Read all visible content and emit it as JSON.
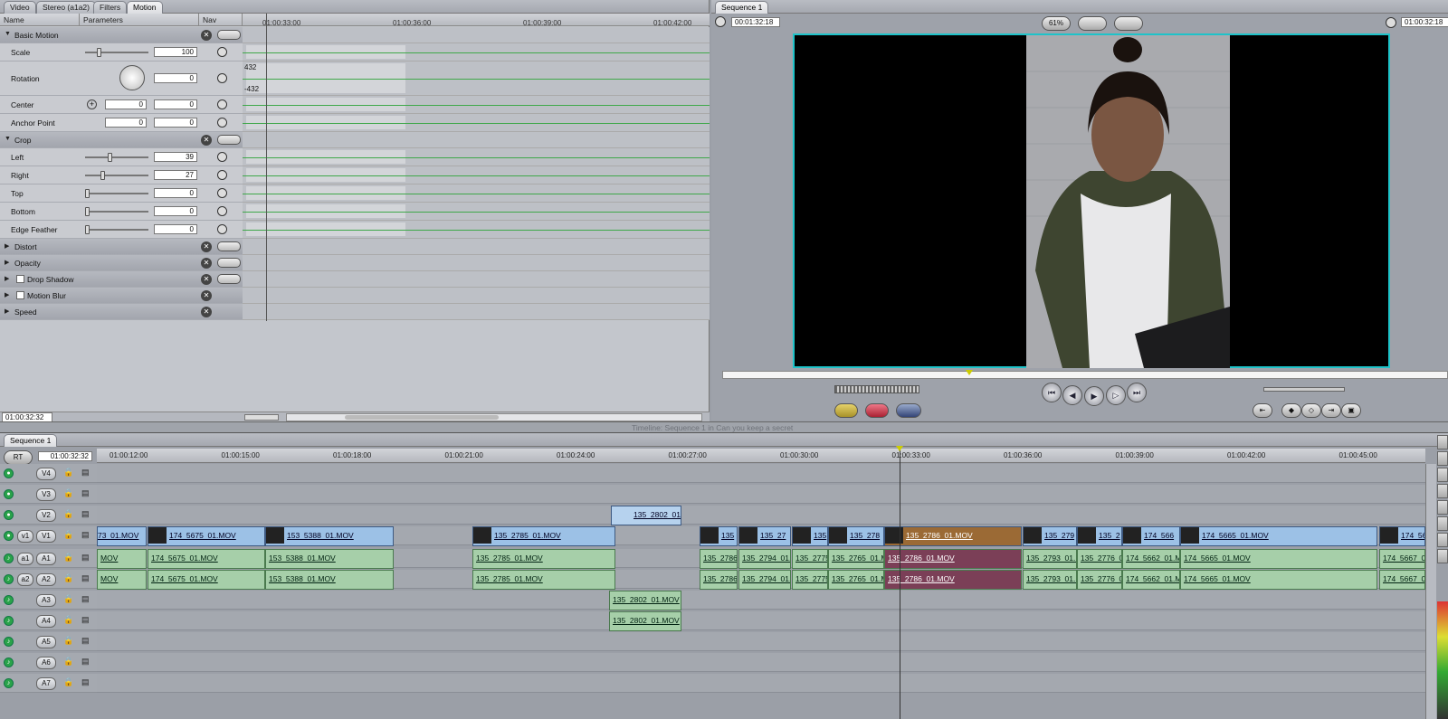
{
  "viewer": {
    "tabs": [
      "Video",
      "Stereo (a1a2)",
      "Filters",
      "Motion"
    ],
    "columns": {
      "name": "Name",
      "params": "Parameters",
      "nav": "Nav"
    },
    "ruler": [
      "01:00:33:00",
      "01:00:36:00",
      "01:00:39:00",
      "01:00:42:00"
    ],
    "timecode": "01:00:32:32",
    "rows": [
      {
        "type": "group",
        "name": "Basic Motion",
        "open": true
      },
      {
        "type": "param",
        "name": "Scale",
        "value": "100",
        "slider": 0.2
      },
      {
        "type": "param",
        "name": "Rotation",
        "value": "0",
        "dial": true,
        "kf_top": "432",
        "kf_bottom": "-432"
      },
      {
        "type": "param",
        "name": "Center",
        "value1": "0",
        "value2": "0",
        "point": true
      },
      {
        "type": "param",
        "name": "Anchor Point",
        "value1": "0",
        "value2": "0"
      },
      {
        "type": "group",
        "name": "Crop",
        "open": true
      },
      {
        "type": "param",
        "name": "Left",
        "value": "39",
        "slider": 0.39
      },
      {
        "type": "param",
        "name": "Right",
        "value": "27",
        "slider": 0.27
      },
      {
        "type": "param",
        "name": "Top",
        "value": "0",
        "slider": 0
      },
      {
        "type": "param",
        "name": "Bottom",
        "value": "0",
        "slider": 0
      },
      {
        "type": "param",
        "name": "Edge Feather",
        "value": "0",
        "slider": 0
      },
      {
        "type": "group",
        "name": "Distort",
        "open": false
      },
      {
        "type": "group",
        "name": "Opacity",
        "open": false
      },
      {
        "type": "group",
        "name": "Drop Shadow",
        "open": false,
        "check": true
      },
      {
        "type": "group",
        "name": "Motion Blur",
        "open": false,
        "check": true
      },
      {
        "type": "group",
        "name": "Speed",
        "open": false
      }
    ]
  },
  "canvas": {
    "tab": "Sequence 1",
    "timecode_left": "00:01:32:18",
    "zoom": "61%",
    "timecode_right": "01:00:32:18"
  },
  "timeline": {
    "title": "Timeline: Sequence 1 in Can you keep a secret",
    "tab": "Sequence 1",
    "rt": "RT",
    "timecode": "01:00:32:32",
    "ticks": [
      "01:00:12:00",
      "01:00:15:00",
      "01:00:18:00",
      "01:00:21:00",
      "01:00:24:00",
      "01:00:27:00",
      "01:00:30:00",
      "01:00:33:00",
      "01:00:36:00",
      "01:00:39:00",
      "01:00:42:00",
      "01:00:45:00"
    ],
    "tracks": [
      "V4",
      "V3",
      "V2",
      "V1",
      "A1",
      "A2",
      "A3",
      "A4",
      "A5",
      "A6",
      "A7"
    ],
    "v1_clips": [
      "73_01.MOV",
      "174_5675_01.MOV",
      "153_5388_01.MOV",
      "135_2785_01.MOV",
      "135",
      "135_27",
      "135",
      "135_278",
      "135_2786_01.MOV",
      "135_279",
      "135_2",
      "174_566",
      "174_5665_01.MOV",
      "174_56"
    ],
    "v2_clip": "135_2802_01",
    "a_clips": [
      "MOV",
      "174_5675_01.MOV",
      "153_5388_01.MOV",
      "135_2785_01.MOV",
      "135_2786",
      "135_2794_01.",
      "135_2775",
      "135_2765_01.M",
      "135_2786_01.MOV",
      "135_2793_01.M",
      "135_2776_0",
      "174_5662_01.M",
      "174_5665_01.MOV",
      "174_5667_0"
    ],
    "a3_clip": "135_2802_01.MOV",
    "a4_clip": "135_2802_01.MOV",
    "v1_dest": "v1",
    "a1_dest": "a1",
    "a2_dest": "a2"
  }
}
